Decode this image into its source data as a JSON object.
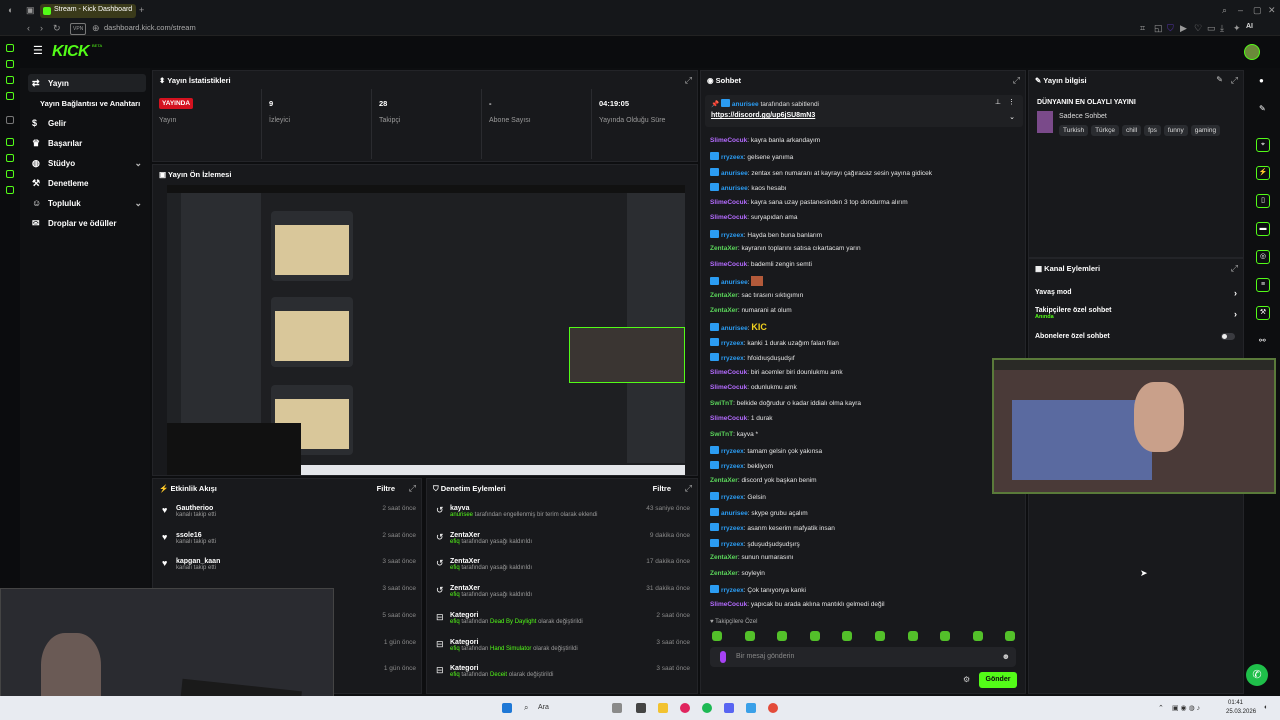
{
  "browser": {
    "tab_title": "Stream - Kick Dashboard",
    "url": "dashboard.kick.com/stream",
    "vpn_label": "VPN",
    "ai_label": "AI"
  },
  "header": {
    "logo": "KICK",
    "beta": "BETA"
  },
  "sidebar": {
    "items": [
      {
        "label": "Yayın",
        "icon": "arrow-icon",
        "active": true
      },
      {
        "label": "Yayın Bağlantısı ve Anahtarı"
      },
      {
        "label": "Gelir",
        "icon": "money-icon"
      },
      {
        "label": "Başarılar",
        "icon": "trophy-icon"
      },
      {
        "label": "Stüdyo",
        "icon": "palette-icon",
        "expandable": true
      },
      {
        "label": "Denetleme",
        "icon": "hammer-icon"
      },
      {
        "label": "Topluluk",
        "icon": "people-icon",
        "expandable": true
      },
      {
        "label": "Droplar ve ödüller",
        "icon": "gift-icon"
      }
    ]
  },
  "stats": {
    "title": "Yayın İstatistikleri",
    "live_badge": "YAYINDA",
    "live_label": "Yayın",
    "items": [
      {
        "value": "9",
        "label": "İzleyici"
      },
      {
        "value": "28",
        "label": "Takipçi"
      },
      {
        "value": "-",
        "label": "Abone Sayısı"
      },
      {
        "value": "04:19:05",
        "label": "Yayında Olduğu Süre"
      }
    ]
  },
  "preview": {
    "title": "Yayın Ön İzlemesi"
  },
  "activity": {
    "title": "Etkinlik Akışı",
    "filter": "Filtre",
    "items": [
      {
        "name": "Gautherioo",
        "sub": "kanalı takip etti",
        "time": "2 saat önce"
      },
      {
        "name": "ssole16",
        "sub": "kanalı takip etti",
        "time": "2 saat önce"
      },
      {
        "name": "kapgan_kaan",
        "sub": "kanalı takip etti",
        "time": "3 saat önce"
      },
      {
        "time": "3 saat önce"
      },
      {
        "time": "5 saat önce"
      },
      {
        "time": "1 gün önce"
      },
      {
        "time": "1 gün önce"
      }
    ]
  },
  "moderation": {
    "title": "Denetim Eylemleri",
    "filter": "Filtre",
    "items": [
      {
        "name": "kayva",
        "actor": "anurisee",
        "rest": " tarafından engellenmiş bir terim olarak eklendi",
        "time": "43 saniye önce"
      },
      {
        "name": "ZentaXer",
        "actor": "efiq",
        "rest": " tarafından yasağı kaldırıldı",
        "time": "9 dakika önce"
      },
      {
        "name": "ZentaXer",
        "actor": "efiq",
        "rest": " tarafından yasağı kaldırıldı",
        "time": "17 dakika önce"
      },
      {
        "name": "ZentaXer",
        "actor": "efiq",
        "rest": " tarafından yasağı kaldırıldı",
        "time": "31 dakika önce"
      },
      {
        "name": "Kategori",
        "actor": "efiq",
        "mid": " tarafından ",
        "game": "Dead By Daylight",
        "rest": " olarak değiştirildi",
        "time": "2 saat önce"
      },
      {
        "name": "Kategori",
        "actor": "efiq",
        "mid": " tarafından ",
        "game": "Hand Simulator",
        "rest": " olarak değiştirildi",
        "time": "3 saat önce"
      },
      {
        "name": "Kategori",
        "actor": "efiq",
        "mid": " tarafından ",
        "game": "Deceit",
        "rest": " olarak değiştirildi",
        "time": "3 saat önce"
      }
    ]
  },
  "chat": {
    "title": "Sohbet",
    "pinned_by": "anurisee",
    "pinned_suffix": " tarafından sabitlendi",
    "pinned_link": "https://discord.gg/up6jSU8mN3",
    "messages": [
      {
        "user": "SlimeCocuk",
        "color": "#b46bff",
        "text": ": kayra banla arkandayım"
      },
      {
        "user": "rryzeex",
        "color": "#2b9cf2",
        "badge": true,
        "text": ": gelsene yanıma"
      },
      {
        "user": "anurisee",
        "color": "#2b9cf2",
        "badge": true,
        "text": ": zentax sen numaranı at kayrayı çağıracaz sesin yayına gidicek"
      },
      {
        "user": "anurisee",
        "color": "#2b9cf2",
        "badge": true,
        "text": ": kaos hesabı"
      },
      {
        "user": "SlimeCocuk",
        "color": "#b46bff",
        "text": ": kayra sana uzay pastanesinden 3 top dondurma alırım"
      },
      {
        "user": "SlimeCocuk",
        "color": "#b46bff",
        "text": ": suryapıdan ama"
      },
      {
        "user": "rryzeex",
        "color": "#2b9cf2",
        "badge": true,
        "text": ": Hayda ben buna banlarım"
      },
      {
        "user": "ZentaXer",
        "color": "#5bd65b",
        "text": ": kayranın toplarını satısa cıkartacam yarın"
      },
      {
        "user": "SlimeCocuk",
        "color": "#b46bff",
        "text": ": bademli zengin semti"
      },
      {
        "user": "anurisee",
        "color": "#2b9cf2",
        "badge": true,
        "text": ":",
        "emote": true
      },
      {
        "user": "ZentaXer",
        "color": "#5bd65b",
        "text": ": sac tırasını sıktıgımın"
      },
      {
        "user": "ZentaXer",
        "color": "#5bd65b",
        "text": ": numarani at olum"
      },
      {
        "user": "anurisee",
        "color": "#2b9cf2",
        "badge": true,
        "text": ":",
        "kic": "KIC"
      },
      {
        "user": "rryzeex",
        "color": "#2b9cf2",
        "badge": true,
        "text": ": kanki 1 durak uzağım falan filan"
      },
      {
        "user": "rryzeex",
        "color": "#2b9cf2",
        "badge": true,
        "text": ": hfoidıuşduşudşıf"
      },
      {
        "user": "SlimeCocuk",
        "color": "#b46bff",
        "text": ": biri acemler biri dounlukmu amk"
      },
      {
        "user": "SlimeCocuk",
        "color": "#b46bff",
        "text": ": odunlukmu amk"
      },
      {
        "user": "SwiTnT",
        "color": "#5bd65b",
        "text": ": belkide doğrudur o kadar iddialı olma kayra"
      },
      {
        "user": "SlimeCocuk",
        "color": "#b46bff",
        "text": ": 1 durak"
      },
      {
        "user": "SwiTnT",
        "color": "#5bd65b",
        "text": ": kayva *"
      },
      {
        "user": "rryzeex",
        "color": "#2b9cf2",
        "badge": true,
        "text": ": tamam gelsin çok yakınsa"
      },
      {
        "user": "rryzeex",
        "color": "#2b9cf2",
        "badge": true,
        "text": ": bekliyom"
      },
      {
        "user": "ZentaXer",
        "color": "#5bd65b",
        "text": ": discord yok başkan benim"
      },
      {
        "user": "rryzeex",
        "color": "#2b9cf2",
        "badge": true,
        "text": ": Gelsin"
      },
      {
        "user": "anurisee",
        "color": "#2b9cf2",
        "badge": true,
        "text": ": skype grubu açalım"
      },
      {
        "user": "rryzeex",
        "color": "#2b9cf2",
        "badge": true,
        "text": ": asanm keserim mafyatik insan"
      },
      {
        "user": "rryzeex",
        "color": "#2b9cf2",
        "badge": true,
        "text": ": şduşudşudşudşırş"
      },
      {
        "user": "ZentaXer",
        "color": "#5bd65b",
        "text": ": sunun numarasını"
      },
      {
        "user": "ZentaXer",
        "color": "#5bd65b",
        "text": ": soyleyin"
      },
      {
        "user": "rryzeex",
        "color": "#2b9cf2",
        "badge": true,
        "text": ": Çok tanıyonya kanki"
      },
      {
        "user": "SlimeCocuk",
        "color": "#b46bff",
        "text": ": yapıcak bu arada aklına mantıklı gelmedi değil"
      }
    ],
    "followers_only": "Takipçilere Özel",
    "input_placeholder": "Bir mesaj gönderin",
    "send_label": "Gönder"
  },
  "stream_info": {
    "title": "Yayın bilgisi",
    "stream_title": "DÜNYANIN EN OLAYLI YAYINI",
    "category": "Sadece Sohbet",
    "tags": [
      "Turkish",
      "Türkçe",
      "chill",
      "fps",
      "funny",
      "gaming"
    ]
  },
  "channel_actions": {
    "title": "Kanal Eylemleri",
    "items": [
      {
        "label": "Yavaş mod"
      },
      {
        "label": "Takipçilere özel sohbet",
        "sub": "Anında"
      },
      {
        "label": "Abonelere özel sohbet"
      }
    ]
  },
  "taskbar": {
    "search": "Ara",
    "time": "01:41",
    "date": "25.03.2026"
  }
}
